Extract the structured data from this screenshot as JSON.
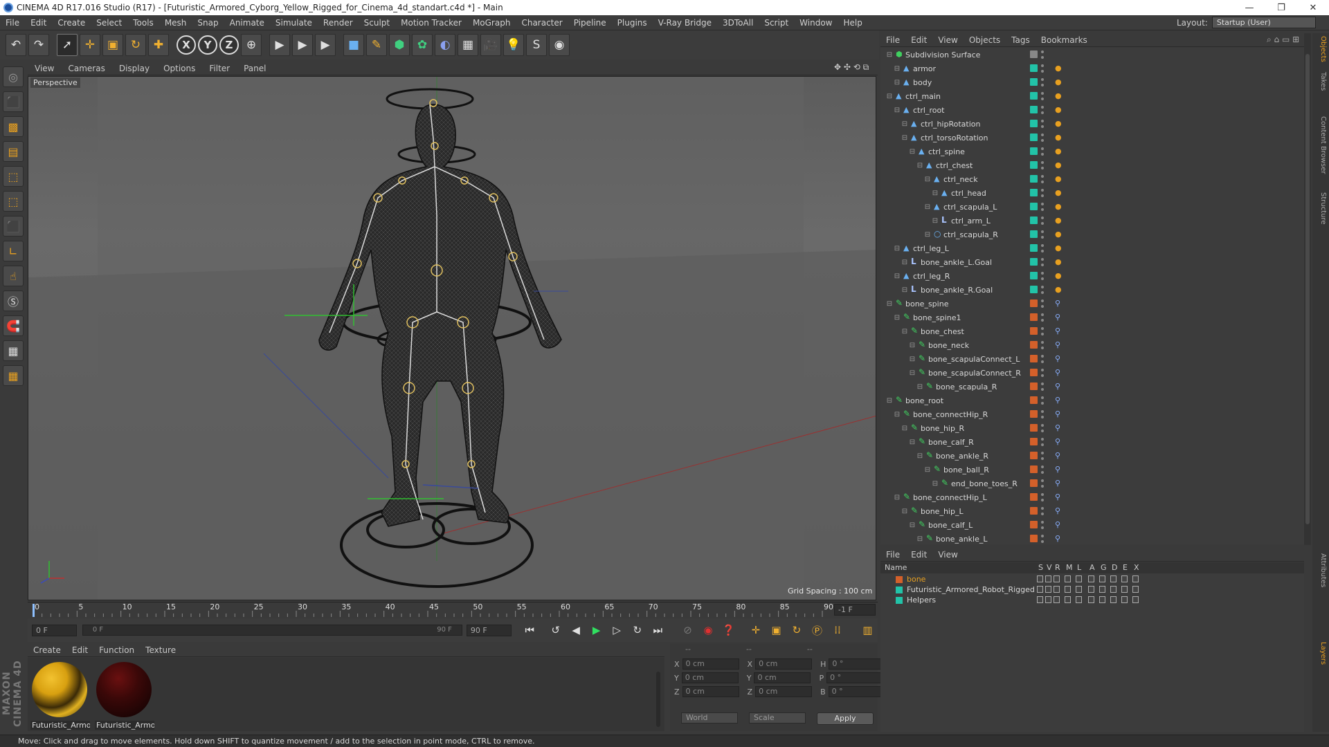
{
  "window": {
    "title": "CINEMA 4D R17.016 Studio (R17) - [Futuristic_Armored_Cyborg_Yellow_Rigged_for_Cinema_4d_standart.c4d *] - Main",
    "min": "—",
    "max": "❐",
    "close": "✕"
  },
  "menu": [
    "File",
    "Edit",
    "Create",
    "Select",
    "Tools",
    "Mesh",
    "Snap",
    "Animate",
    "Simulate",
    "Render",
    "Sculpt",
    "Motion Tracker",
    "MoGraph",
    "Character",
    "Pipeline",
    "Plugins",
    "V-Ray Bridge",
    "3DToAll",
    "Script",
    "Window",
    "Help"
  ],
  "layout": {
    "label": "Layout:",
    "value": "Startup (User)"
  },
  "toolbar": {
    "undo": "↶",
    "redo": "↷",
    "select": "➚",
    "move": "✛",
    "scale": "▣",
    "rotate": "↻",
    "add": "✚",
    "x": "X",
    "y": "Y",
    "z": "Z",
    "coord": "⊕",
    "render1": "▶",
    "render2": "▶",
    "render3": "▶",
    "cube": "■",
    "pen": "✎",
    "gen": "⬢",
    "deform": "✿",
    "scene": "◐",
    "floor": "▦",
    "cam": "🎥",
    "light": "💡",
    "py1": "S",
    "py2": "◉"
  },
  "viewport": {
    "menu": [
      "View",
      "Cameras",
      "Display",
      "Options",
      "Filter",
      "Panel"
    ],
    "label": "Perspective",
    "grid_spacing": "Grid Spacing : 100 cm",
    "nav_icons": "✥ ✣ ⟲ ⧉"
  },
  "timeline": {
    "ticks": [
      0,
      5,
      10,
      15,
      20,
      25,
      30,
      35,
      40,
      45,
      50,
      55,
      60,
      65,
      70,
      75,
      80,
      85,
      90
    ],
    "end_field": "-1 F",
    "start": "0 F",
    "range_start": "0 F",
    "range_end": "90 F",
    "end": "90 F"
  },
  "materials": {
    "menu": [
      "Create",
      "Edit",
      "Function",
      "Texture"
    ],
    "items": [
      {
        "label": "Futuristic_Armor"
      },
      {
        "label": "Futuristic_Armor"
      }
    ]
  },
  "coords": {
    "header": [
      "--",
      "--",
      "--"
    ],
    "rows": [
      {
        "a": "X",
        "av": "0 cm",
        "b": "X",
        "bv": "0 cm",
        "c": "H",
        "cv": "0 °"
      },
      {
        "a": "Y",
        "av": "0 cm",
        "b": "Y",
        "bv": "0 cm",
        "c": "P",
        "cv": "0 °"
      },
      {
        "a": "Z",
        "av": "0 cm",
        "b": "Z",
        "bv": "0 cm",
        "c": "B",
        "cv": "0 °"
      }
    ],
    "world": "World",
    "scale": "Scale",
    "apply": "Apply"
  },
  "status": "Move: Click and drag to move elements. Hold down SHIFT to quantize movement / add to the selection in point mode, CTRL to remove.",
  "maxon": "MAXON CINEMA 4D",
  "objects": {
    "menu": [
      "File",
      "Edit",
      "View",
      "Objects",
      "Tags",
      "Bookmarks"
    ],
    "rows": [
      {
        "name": "Subdivision Surface",
        "level": 0,
        "type": "subd",
        "color": "#888888"
      },
      {
        "name": "armor",
        "level": 1,
        "type": "null",
        "color": "#22c3a8"
      },
      {
        "name": "body",
        "level": 1,
        "type": "null",
        "color": "#22c3a8"
      },
      {
        "name": "ctrl_main",
        "level": 0,
        "type": "null",
        "color": "#22c3a8"
      },
      {
        "name": "ctrl_root",
        "level": 1,
        "type": "null",
        "color": "#22c3a8"
      },
      {
        "name": "ctrl_hipRotation",
        "level": 2,
        "type": "null",
        "color": "#22c3a8"
      },
      {
        "name": "ctrl_torsoRotation",
        "level": 2,
        "type": "null",
        "color": "#22c3a8"
      },
      {
        "name": "ctrl_spine",
        "level": 3,
        "type": "null",
        "color": "#22c3a8"
      },
      {
        "name": "ctrl_chest",
        "level": 4,
        "type": "null",
        "color": "#22c3a8"
      },
      {
        "name": "ctrl_neck",
        "level": 5,
        "type": "null",
        "color": "#22c3a8"
      },
      {
        "name": "ctrl_head",
        "level": 6,
        "type": "null",
        "color": "#22c3a8"
      },
      {
        "name": "ctrl_scapula_L",
        "level": 5,
        "type": "null",
        "color": "#22c3a8"
      },
      {
        "name": "ctrl_arm_L",
        "level": 6,
        "type": "goal",
        "color": "#22c3a8"
      },
      {
        "name": "ctrl_scapula_R",
        "level": 5,
        "type": "circle",
        "color": "#22c3a8"
      },
      {
        "name": "ctrl_leg_L",
        "level": 1,
        "type": "null",
        "color": "#22c3a8"
      },
      {
        "name": "bone_ankle_L.Goal",
        "level": 2,
        "type": "goal",
        "color": "#22c3a8"
      },
      {
        "name": "ctrl_leg_R",
        "level": 1,
        "type": "null",
        "color": "#22c3a8"
      },
      {
        "name": "bone_ankle_R.Goal",
        "level": 2,
        "type": "goal",
        "color": "#22c3a8"
      },
      {
        "name": "bone_spine",
        "level": 0,
        "type": "bone",
        "color": "#d4602a"
      },
      {
        "name": "bone_spine1",
        "level": 1,
        "type": "bone",
        "color": "#d4602a"
      },
      {
        "name": "bone_chest",
        "level": 2,
        "type": "bone",
        "color": "#d4602a"
      },
      {
        "name": "bone_neck",
        "level": 3,
        "type": "bone",
        "color": "#d4602a"
      },
      {
        "name": "bone_scapulaConnect_L",
        "level": 3,
        "type": "bone",
        "color": "#d4602a"
      },
      {
        "name": "bone_scapulaConnect_R",
        "level": 3,
        "type": "bone",
        "color": "#d4602a"
      },
      {
        "name": "bone_scapula_R",
        "level": 4,
        "type": "bone",
        "color": "#d4602a"
      },
      {
        "name": "bone_root",
        "level": 0,
        "type": "bone",
        "color": "#d4602a"
      },
      {
        "name": "bone_connectHip_R",
        "level": 1,
        "type": "bone",
        "color": "#d4602a"
      },
      {
        "name": "bone_hip_R",
        "level": 2,
        "type": "bone",
        "color": "#d4602a"
      },
      {
        "name": "bone_calf_R",
        "level": 3,
        "type": "bone",
        "color": "#d4602a"
      },
      {
        "name": "bone_ankle_R",
        "level": 4,
        "type": "bone",
        "color": "#d4602a"
      },
      {
        "name": "bone_ball_R",
        "level": 5,
        "type": "bone",
        "color": "#d4602a"
      },
      {
        "name": "end_bone_toes_R",
        "level": 6,
        "type": "bone",
        "color": "#d4602a"
      },
      {
        "name": "bone_connectHip_L",
        "level": 1,
        "type": "bone",
        "color": "#d4602a"
      },
      {
        "name": "bone_hip_L",
        "level": 2,
        "type": "bone",
        "color": "#d4602a"
      },
      {
        "name": "bone_calf_L",
        "level": 3,
        "type": "bone",
        "color": "#d4602a"
      },
      {
        "name": "bone_ankle_L",
        "level": 4,
        "type": "bone",
        "color": "#d4602a"
      }
    ]
  },
  "layers": {
    "menu": [
      "File",
      "Edit",
      "View"
    ],
    "cols": [
      "Name",
      "S",
      "V",
      "R",
      "M",
      "L",
      "A",
      "G",
      "D",
      "E",
      "X"
    ],
    "rows": [
      {
        "name": "bone",
        "color": "#d4602a",
        "text_color": "#e8a020"
      },
      {
        "name": "Futuristic_Armored_Robot_Rigged",
        "color": "#22c3a8",
        "text_color": "#d8d8d8"
      },
      {
        "name": "Helpers",
        "color": "#22c3a8",
        "text_color": "#d8d8d8"
      }
    ]
  },
  "side_tabs": [
    "Objects",
    "Takes",
    "Content Browser",
    "Structure",
    "Attributes",
    "Layers"
  ]
}
